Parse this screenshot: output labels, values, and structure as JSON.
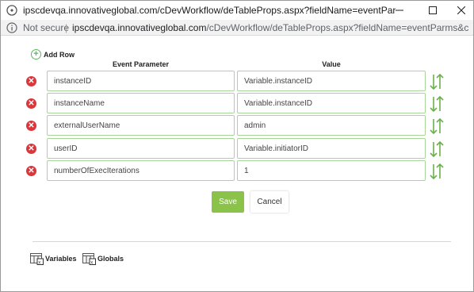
{
  "window": {
    "title": "ipscdevqa.innovativeglobal.com/cDevWorkflow/deTableProps.aspx?fieldName=eventParms&cols=Event Parameter, Val...",
    "minimize_icon": "minimize-icon",
    "maximize_icon": "maximize-icon",
    "close_icon": "close-icon"
  },
  "address": {
    "security_label": "Not secure",
    "separator": "|",
    "url_host": "ipscdevqa.innovativeglobal.com",
    "url_rest": "/cDevWorkflow/deTableProps.aspx?fieldName=eventParms&cols=Event%..."
  },
  "toolbar": {
    "add_row_label": "Add Row"
  },
  "table": {
    "columns": [
      "Event Parameter",
      "Value"
    ],
    "rows": [
      {
        "param": "instanceID",
        "value": "Variable.instanceID"
      },
      {
        "param": "instanceName",
        "value": "Variable.instanceID"
      },
      {
        "param": "externalUserName",
        "value": "admin"
      },
      {
        "param": "userID",
        "value": "Variable.initiatorID"
      },
      {
        "param": "numberOfExecIterations",
        "value": "1"
      }
    ]
  },
  "actions": {
    "save_label": "Save",
    "cancel_label": "Cancel"
  },
  "footer": {
    "variables_label": "Variables",
    "globals_label": "Globals"
  },
  "colors": {
    "accent_green": "#8bc34a",
    "field_border": "#a8d59a",
    "delete_red": "#d9373b"
  }
}
